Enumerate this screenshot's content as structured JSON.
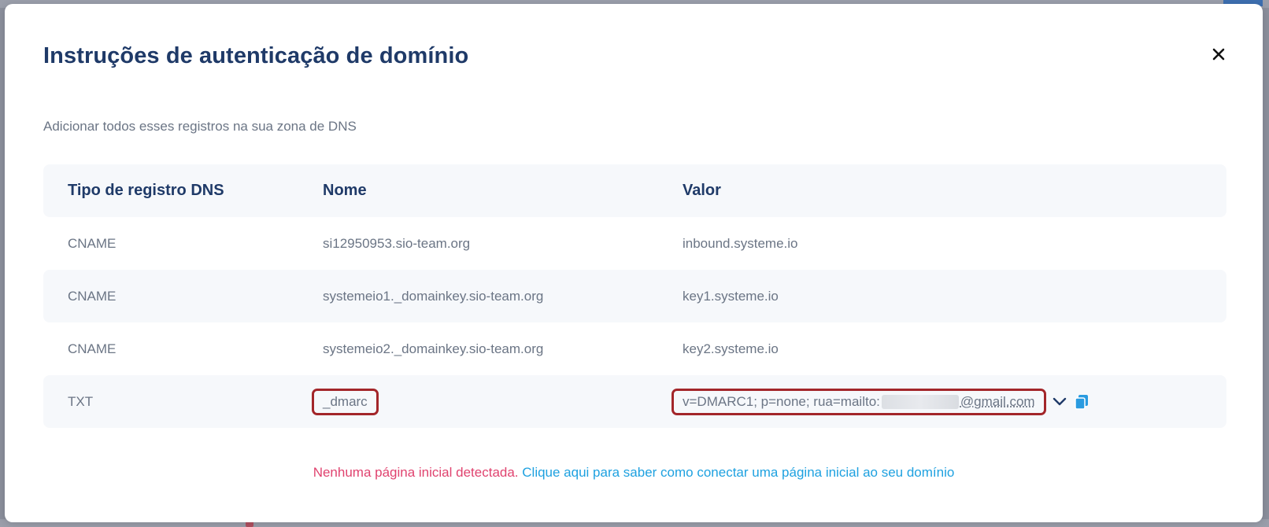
{
  "modal": {
    "title": "Instruções de autenticação de domínio",
    "subtitle": "Adicionar todos esses registros na sua zona de DNS",
    "close_icon": "close-icon"
  },
  "table": {
    "headers": [
      "Tipo de registro DNS",
      "Nome",
      "Valor"
    ],
    "rows": [
      {
        "type": "CNAME",
        "name": "si12950953.sio-team.org",
        "value": "inbound.systeme.io"
      },
      {
        "type": "CNAME",
        "name": "systemeio1._domainkey.sio-team.org",
        "value": "key1.systeme.io"
      },
      {
        "type": "CNAME",
        "name": "systemeio2._domainkey.sio-team.org",
        "value": "key2.systeme.io"
      },
      {
        "type": "TXT",
        "name": "_dmarc",
        "value_prefix": "v=DMARC1; p=none; rua=mailto:",
        "value_suffix": "@gmail.com"
      }
    ],
    "expand_icon": "chevron-down-icon",
    "copy_icon": "copy-icon"
  },
  "footer": {
    "warning": "Nenhuma página inicial detectada.",
    "link": "Clique aqui para saber como conectar uma página inicial ao seu domínio"
  },
  "colors": {
    "title": "#1f3a68",
    "highlight_border": "#a3262a",
    "warning": "#e0436f",
    "link": "#1ea1e0",
    "copy_icon": "#2a9be0"
  }
}
